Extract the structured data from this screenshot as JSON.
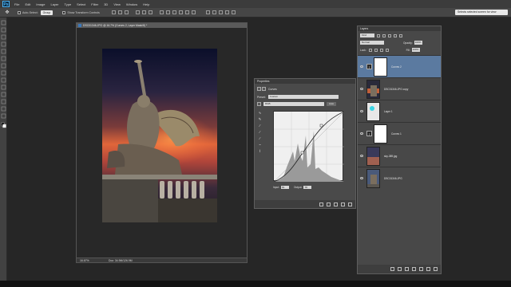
{
  "menubar": {
    "logo": "Ps",
    "items": [
      "File",
      "Edit",
      "Image",
      "Layer",
      "Type",
      "Select",
      "Filter",
      "3D",
      "View",
      "Window",
      "Help"
    ]
  },
  "options": {
    "tool_icon": "move-tool-icon",
    "auto_select_label": "Auto-Select:",
    "auto_select_value": "Group",
    "transform_label": "Show Transform Controls",
    "workspace": "Selects selected screen for view"
  },
  "document": {
    "tab_title": "DSC01346.JPG @ 16.7% (Curves 2, Layer Mask/8) *",
    "zoom": "16.67%",
    "info": "Doc: 34.9M/126.9M"
  },
  "properties": {
    "tab_label": "Properties",
    "type_label": "Curves",
    "preset_label": "Preset:",
    "preset_value": "Custom",
    "channel_value": "RGB",
    "auto_label": "Auto",
    "input_label": "Input:",
    "input_value": "81",
    "output_label": "Output:",
    "output_value": "78"
  },
  "layers": {
    "tab_label": "Layers",
    "filter_label": "Kind",
    "blend_mode": "Normal",
    "opacity_label": "Opacity:",
    "opacity_value": "100%",
    "lock_label": "Lock:",
    "fill_label": "Fill:",
    "fill_value": "100%",
    "items": [
      {
        "name": "Curves 2",
        "kind": "adjustment",
        "selected": true
      },
      {
        "name": "DSC01346.JPG copy",
        "kind": "photo",
        "selected": false
      },
      {
        "name": "Layer 1",
        "kind": "transparent",
        "selected": false
      },
      {
        "name": "Curves 1",
        "kind": "adjustment",
        "selected": false
      },
      {
        "name": "sky-389.jpg",
        "kind": "sky",
        "selected": false
      },
      {
        "name": "DSC01346.JPG",
        "kind": "photo",
        "selected": false
      }
    ]
  },
  "colors": {
    "accent_selected": "#5b7aa0",
    "sky_glow": "#e0663a",
    "panel_bg": "#484848"
  }
}
